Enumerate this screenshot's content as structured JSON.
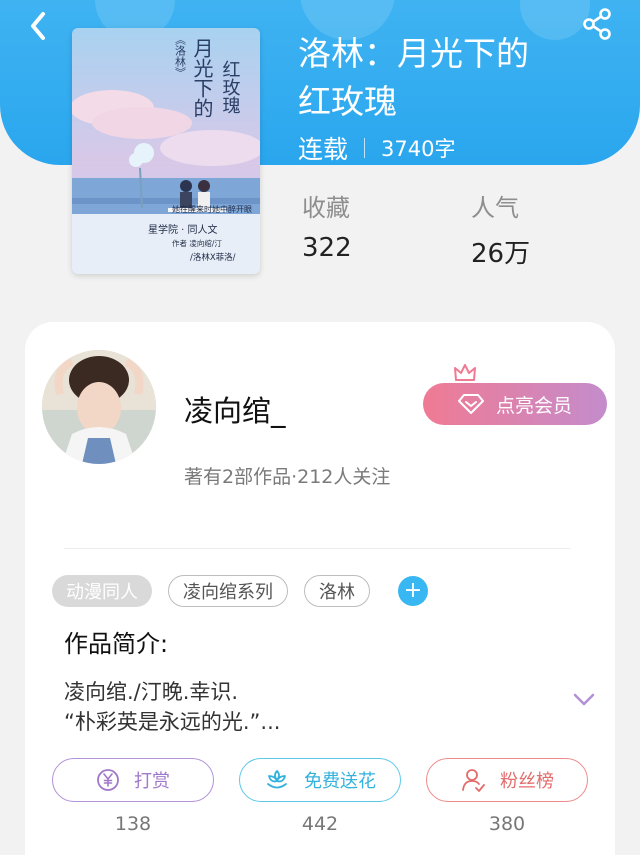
{
  "header": {
    "back_icon": "back-arrow-icon",
    "share_icon": "share-icon",
    "bg_color": "#2ea8ef"
  },
  "cover": {
    "title_vertical_1": "月光下的",
    "title_vertical_2": "红玫瑰",
    "tag_vertical": "《洛林》",
    "line_1": "她在醒来时她中醉开眼",
    "line_2": "星学院 · 同人文",
    "line_3": "作者 凌向绾/汀",
    "line_4": "/洛林X菲洛/"
  },
  "book": {
    "title_line1": "洛林：月光下的",
    "title_line2": "红玫瑰",
    "status": "连载",
    "word_count": "3740字"
  },
  "stats": {
    "favorites_label": "收藏",
    "favorites_value": "322",
    "popularity_label": "人气",
    "popularity_value": "26万"
  },
  "author": {
    "name": "凌向绾_",
    "meta": "著有2部作品·212人关注",
    "vip_button": "点亮会员",
    "vip_icon": "diamond-icon",
    "crown_icon": "crown-icon"
  },
  "tags": [
    "动漫同人",
    "凌向绾系列",
    "洛林"
  ],
  "tag_add_label": "+",
  "intro": {
    "heading": "作品简介:",
    "line1": "凌向绾./汀晚.幸识.",
    "line2": "“朴彩英是永远的光.”...",
    "expand_icon": "chevron-down-icon"
  },
  "actions": [
    {
      "label": "打赏",
      "count": "138",
      "icon": "yen-coin-icon",
      "color": "#a079cc"
    },
    {
      "label": "免费送花",
      "count": "442",
      "icon": "flower-icon",
      "color": "#34b2dd"
    },
    {
      "label": "粉丝榜",
      "count": "380",
      "icon": "person-icon",
      "color": "#e36c6c"
    }
  ]
}
